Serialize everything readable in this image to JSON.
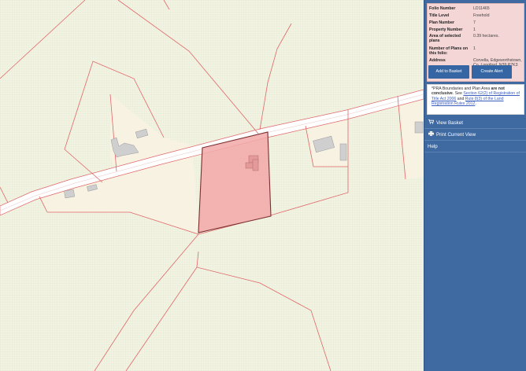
{
  "folio": {
    "rows": [
      {
        "label": "Folio Number",
        "value": "LD11465"
      },
      {
        "label": "Title Level",
        "value": "Freehold"
      },
      {
        "label": "Plan Number",
        "value": "7"
      },
      {
        "label": "Property Number",
        "value": "1"
      },
      {
        "label": "Area of selected plans",
        "value": "0.39 hectares."
      },
      {
        "label": "Number of Plans on this folio:",
        "value": "1"
      },
      {
        "label": "Address",
        "value": "Corvella, Edgeworthstown, Co. Longford, N39 P7K3"
      }
    ],
    "add_to_basket": "Add to Basket",
    "create_alert": "Create Alert"
  },
  "notice": {
    "prefix": "*PRA Boundaries and Plan Area ",
    "bold": "are not conclusive",
    "mid1": ". See ",
    "link1": "Section 62(2) of Registration of Title Act 2006",
    "mid2": " and ",
    "link2": "Rule 8(3) of the Land Registration Rules 2012",
    "suffix": "."
  },
  "nav": {
    "view_basket": "View Basket",
    "print_view": "Print Current View",
    "help": "Help"
  },
  "icons": {
    "basket": "cart-icon",
    "print": "printer-icon"
  },
  "colors": {
    "sidebar": "#3f6aa1",
    "card": "#f5d6d6",
    "button": "#3566a3",
    "parcel": "#f2a8a8",
    "boundary": "#e06666"
  }
}
